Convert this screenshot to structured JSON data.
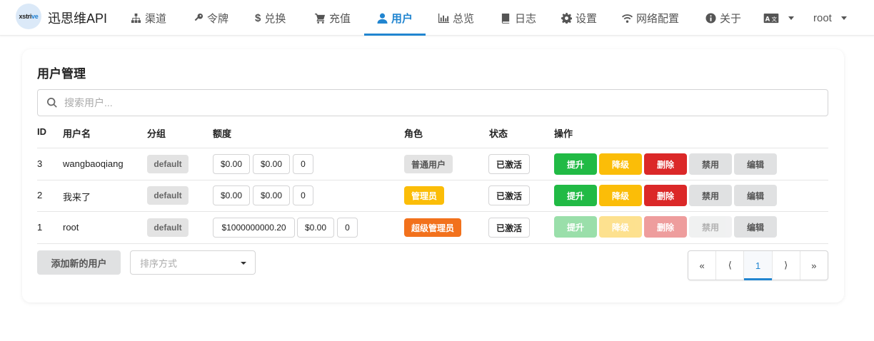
{
  "brand": {
    "logo_text_a": "xstri",
    "logo_text_b": "ve",
    "name": "迅思维API"
  },
  "nav": {
    "items": [
      {
        "label": "渠道",
        "icon": "sitemap-icon"
      },
      {
        "label": "令牌",
        "icon": "key-icon"
      },
      {
        "label": "兑换",
        "icon": "dollar-icon"
      },
      {
        "label": "充值",
        "icon": "cart-icon"
      },
      {
        "label": "用户",
        "icon": "user-icon",
        "active": true
      },
      {
        "label": "总览",
        "icon": "bar-chart-icon"
      },
      {
        "label": "日志",
        "icon": "book-icon"
      },
      {
        "label": "设置",
        "icon": "gear-icon"
      },
      {
        "label": "网络配置",
        "icon": "wifi-icon"
      },
      {
        "label": "关于",
        "icon": "info-icon"
      }
    ],
    "language_icon": "language-icon",
    "account": "root"
  },
  "page": {
    "title": "用户管理",
    "search_placeholder": "搜索用户..."
  },
  "table": {
    "headers": {
      "id": "ID",
      "username": "用户名",
      "group": "分组",
      "quota": "额度",
      "role": "角色",
      "status": "状态",
      "actions": "操作"
    },
    "rows": [
      {
        "id": "3",
        "username": "wangbaoqiang",
        "group": "default",
        "quota": "$0.00",
        "used": "$0.00",
        "requests": "0",
        "role": "普通用户",
        "status": "已激活"
      },
      {
        "id": "2",
        "username": "我来了",
        "group": "default",
        "quota": "$0.00",
        "used": "$0.00",
        "requests": "0",
        "role": "管理员",
        "status": "已激活"
      },
      {
        "id": "1",
        "username": "root",
        "group": "default",
        "quota": "$1000000000.20",
        "used": "$0.00",
        "requests": "0",
        "role": "超级管理员",
        "status": "已激活"
      }
    ],
    "action_labels": {
      "promote": "提升",
      "demote": "降级",
      "delete": "删除",
      "disable": "禁用",
      "edit": "编辑"
    }
  },
  "footer": {
    "add_user": "添加新的用户",
    "sort_placeholder": "排序方式",
    "pagination": {
      "first": "«",
      "prev": "⟨",
      "current": "1",
      "next": "⟩",
      "last": "»"
    }
  },
  "colors": {
    "accent": "#2185d0",
    "green": "#21ba45",
    "yellow": "#fbbd08",
    "red": "#db2828",
    "orange": "#f2711c"
  }
}
